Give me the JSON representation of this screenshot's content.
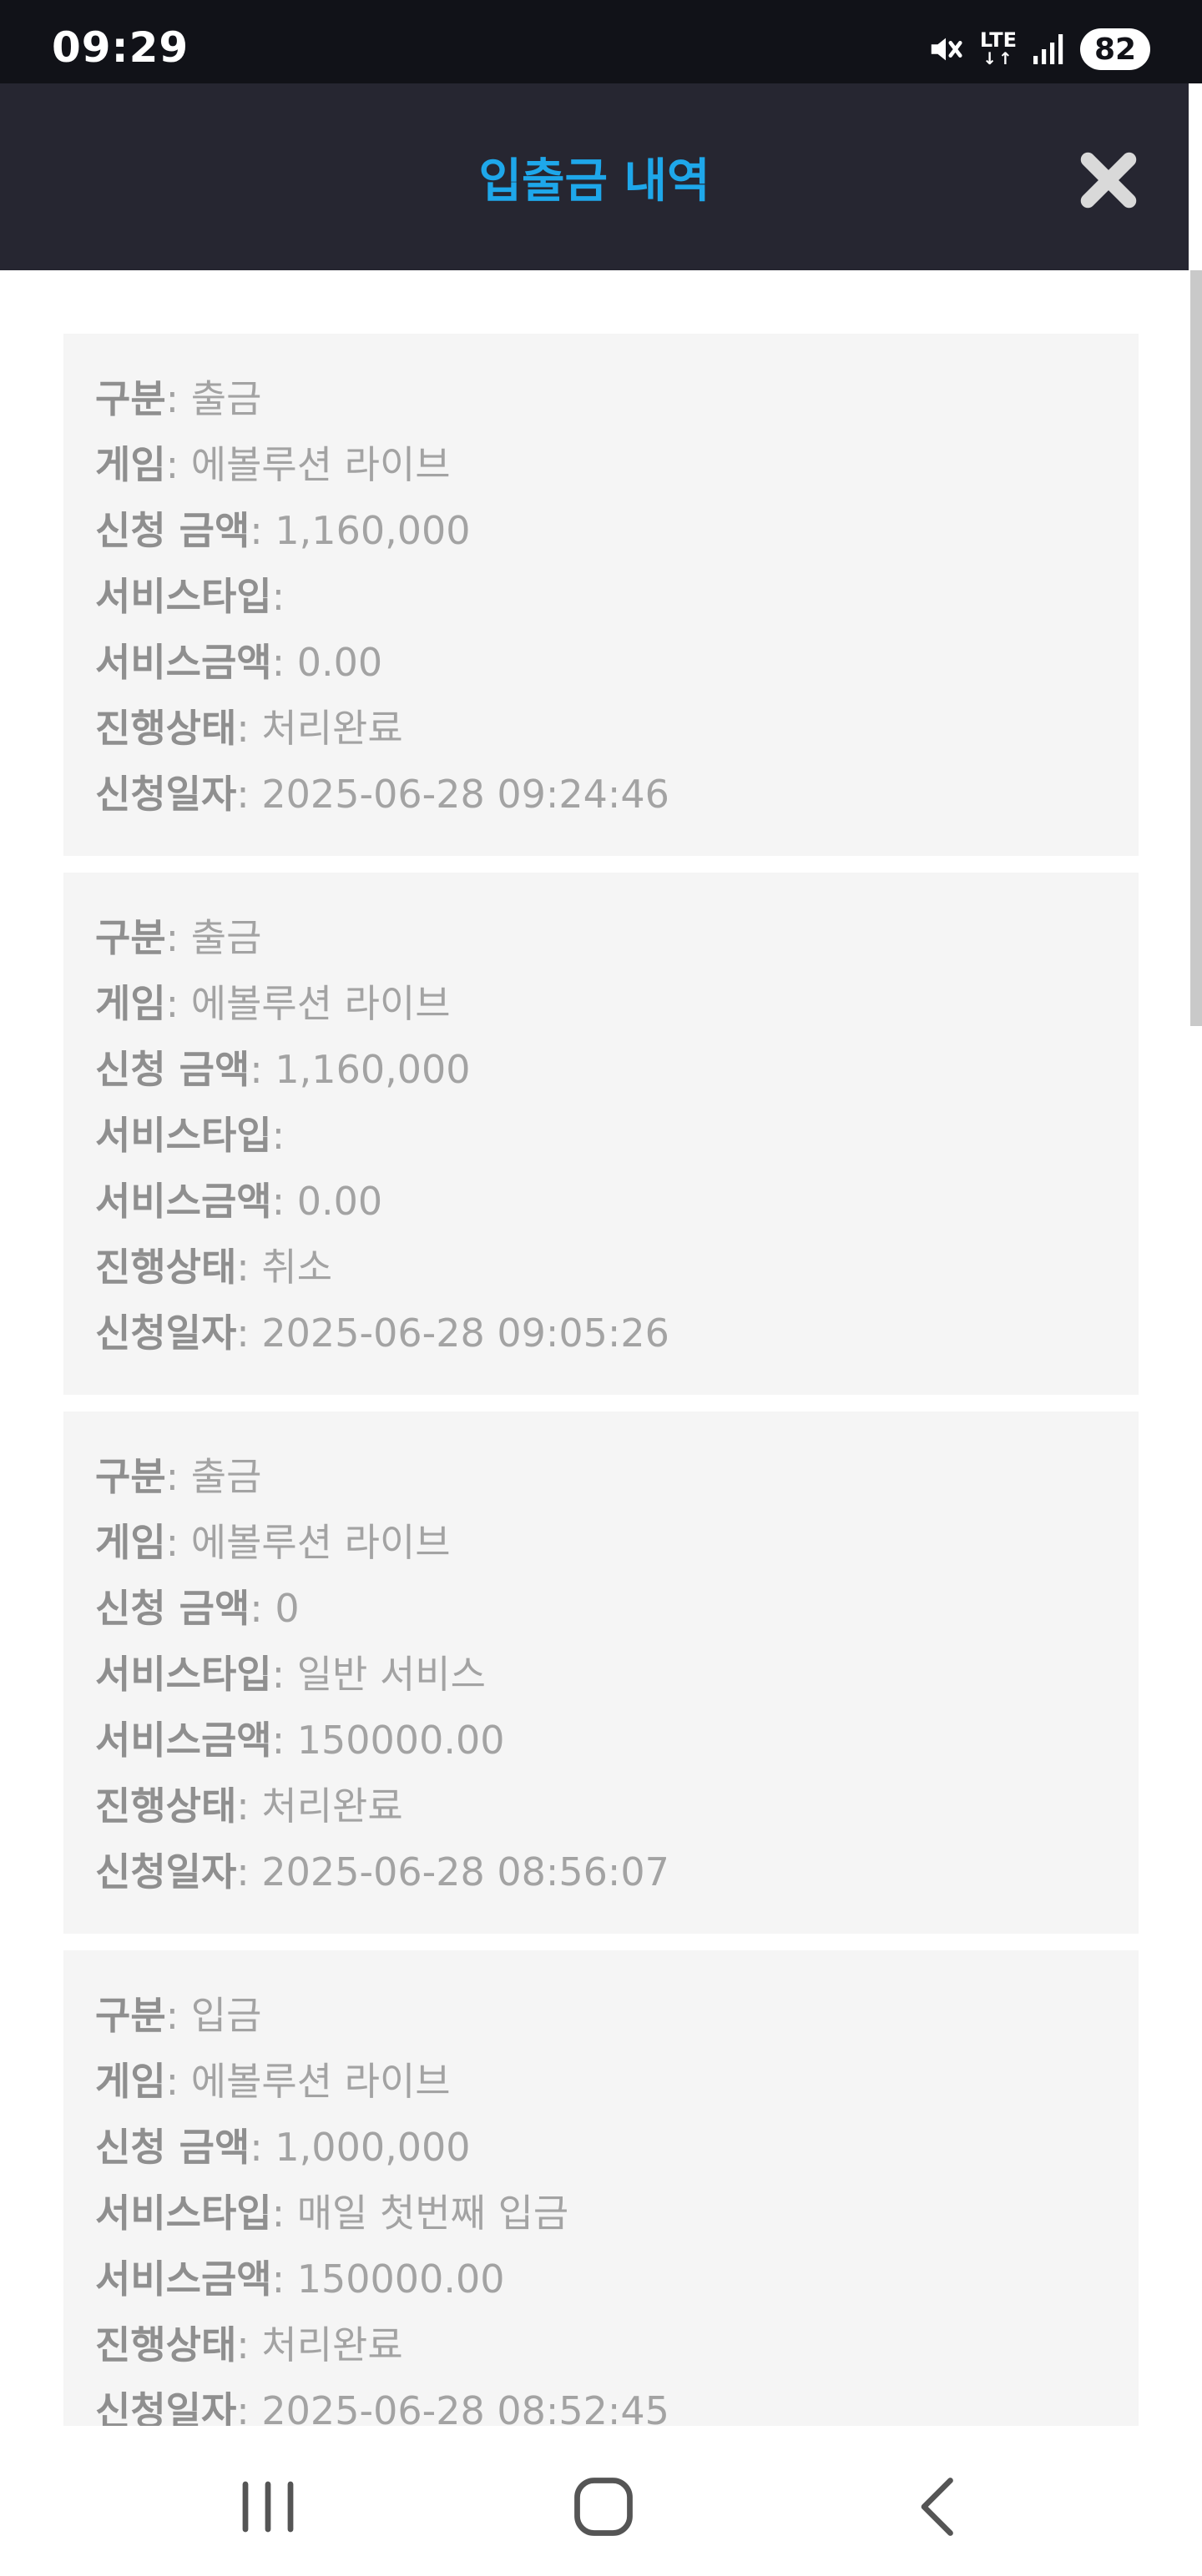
{
  "status_bar": {
    "time": "09:29",
    "network": "LTE",
    "network_arrows": "↓↑",
    "battery": "82",
    "icons": [
      "mute-icon",
      "lte-icon",
      "signal-icon",
      "battery-icon"
    ]
  },
  "header": {
    "title": "입출금 내역",
    "close_icon": "close-icon"
  },
  "labels": {
    "type": "구분",
    "game": "게임",
    "amount": "신청 금액",
    "service_type": "서비스타입",
    "service_amount": "서비스금액",
    "status": "진행상태",
    "date": "신청일자"
  },
  "records": [
    {
      "type": ": 출금",
      "game": ": 에볼루션 라이브",
      "amount": ": 1,160,000",
      "service_type": ":",
      "service_amount": ": 0.00",
      "status": ": 처리완료",
      "date": ": 2025-06-28 09:24:46"
    },
    {
      "type": ": 출금",
      "game": ": 에볼루션 라이브",
      "amount": ": 1,160,000",
      "service_type": ":",
      "service_amount": ": 0.00",
      "status": ": 취소",
      "date": ": 2025-06-28 09:05:26"
    },
    {
      "type": ": 출금",
      "game": ": 에볼루션 라이브",
      "amount": ": 0",
      "service_type": ": 일반 서비스",
      "service_amount": ": 150000.00",
      "status": ": 처리완료",
      "date": ": 2025-06-28 08:56:07"
    },
    {
      "type": ": 입금",
      "game": ": 에볼루션 라이브",
      "amount": ": 1,000,000",
      "service_type": ": 매일 첫번째 입금",
      "service_amount": ": 150000.00",
      "status": ": 처리완료",
      "date": ": 2025-06-28 08:52:45"
    }
  ],
  "nav_bar": {
    "icons": [
      "recent-apps-icon",
      "home-icon",
      "back-icon"
    ]
  },
  "colors": {
    "header_bg": "#262631",
    "title": "#1ea7ea",
    "card_bg": "#f5f5f5",
    "text": "#a3a3a3"
  }
}
